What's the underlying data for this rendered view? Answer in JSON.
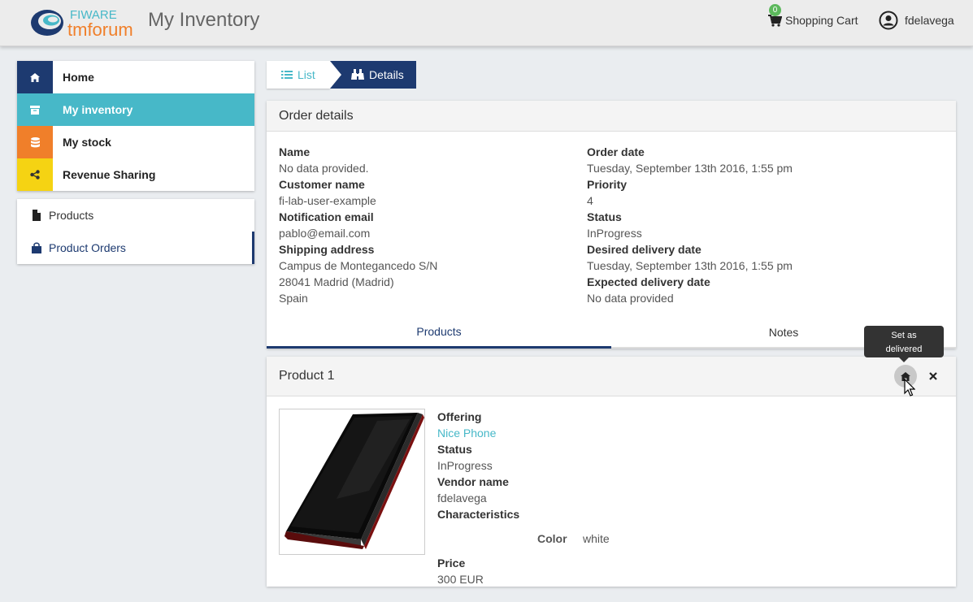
{
  "header": {
    "logo_top": "FIWARE",
    "logo_bottom": "tmforum",
    "title": "My Inventory",
    "cart_count": "0",
    "cart_label": "Shopping Cart",
    "user_name": "fdelavega",
    "cart_icon": "shopping-cart-icon",
    "user_icon": "user-circle-icon"
  },
  "sidebar": {
    "items": [
      {
        "label": "Home",
        "icon": "home-icon",
        "color": "#1d3a70"
      },
      {
        "label": "My inventory",
        "icon": "archive-icon",
        "color": "#47b8c8"
      },
      {
        "label": "My stock",
        "icon": "database-icon",
        "color": "#f07f2a"
      },
      {
        "label": "Revenue Sharing",
        "icon": "share-icon",
        "color": "#f5d313"
      }
    ],
    "subitems": [
      {
        "label": "Products",
        "icon": "file-icon"
      },
      {
        "label": "Product Orders",
        "icon": "shopping-bag-icon"
      }
    ]
  },
  "breadcrumb": {
    "list_label": "List",
    "details_label": "Details"
  },
  "order": {
    "panel_title": "Order details",
    "left": [
      {
        "label": "Name",
        "values": [
          "No data provided."
        ]
      },
      {
        "label": "Customer name",
        "values": [
          "fi-lab-user-example"
        ]
      },
      {
        "label": "Notification email",
        "values": [
          "pablo@email.com"
        ]
      },
      {
        "label": "Shipping address",
        "values": [
          "Campus de Montegancedo S/N",
          "28041 Madrid (Madrid)",
          "Spain"
        ]
      }
    ],
    "right": [
      {
        "label": "Order date",
        "values": [
          "Tuesday, September 13th 2016, 1:55 pm"
        ]
      },
      {
        "label": "Priority",
        "values": [
          "4"
        ]
      },
      {
        "label": "Status",
        "values": [
          "InProgress"
        ]
      },
      {
        "label": "Desired delivery date",
        "values": [
          "Tuesday, September 13th 2016, 1:55 pm"
        ]
      },
      {
        "label": "Expected delivery date",
        "values": [
          "No data provided"
        ]
      }
    ],
    "tabs": [
      "Products",
      "Notes"
    ],
    "active_tab": "Products"
  },
  "product": {
    "title": "Product 1",
    "tooltip": "Set as delivered",
    "tooltip_line1": "Set as",
    "tooltip_line2": "delivered",
    "offering_label": "Offering",
    "offering_value": "Nice Phone",
    "status_label": "Status",
    "status_value": "InProgress",
    "vendor_label": "Vendor name",
    "vendor_value": "fdelavega",
    "characteristics_label": "Characteristics",
    "char_name": "Color",
    "char_value": "white",
    "price_label": "Price",
    "price_value": "300 EUR",
    "deliver_icon": "home-icon",
    "remove_icon": "close-icon"
  }
}
